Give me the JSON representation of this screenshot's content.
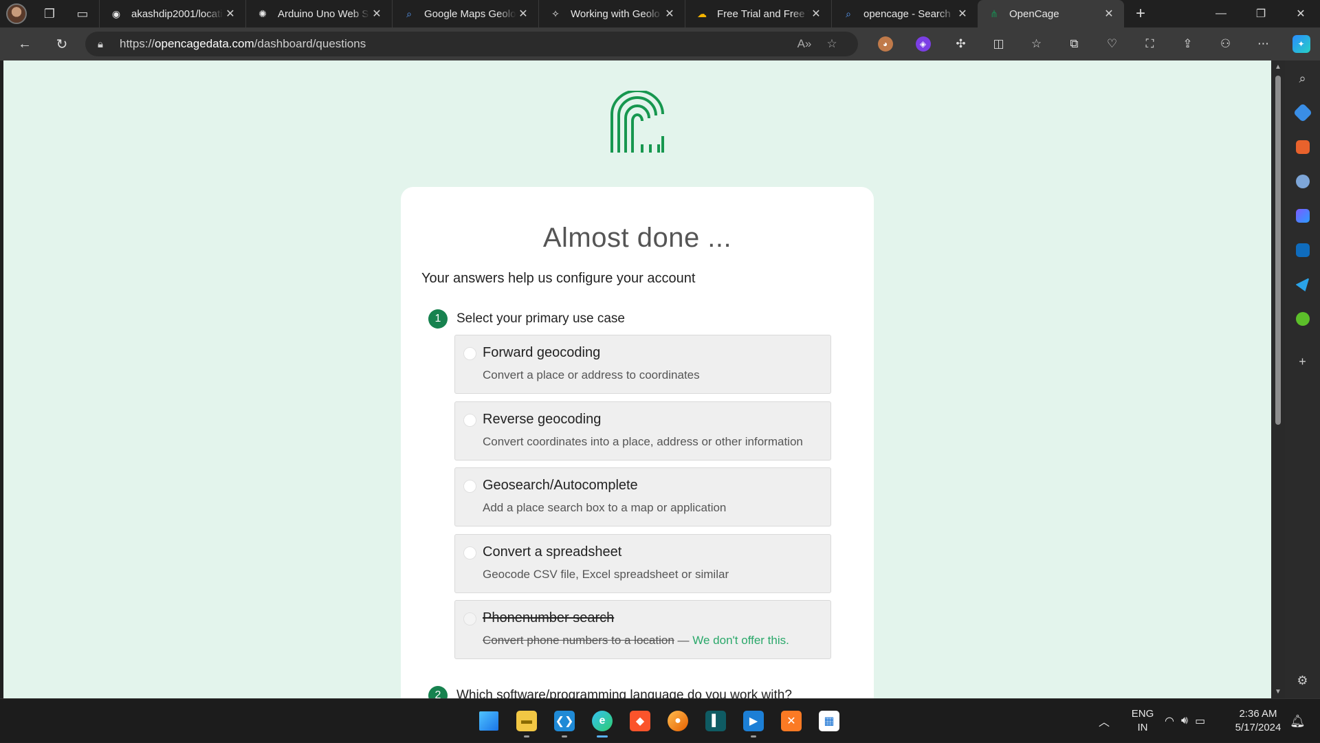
{
  "browser": {
    "tabs": [
      {
        "title": "akashdip2001/locati",
        "icon": "github-icon",
        "glyph": "◉"
      },
      {
        "title": "Arduino Uno Web S",
        "icon": "chatgpt-icon",
        "glyph": "✺"
      },
      {
        "title": "Google Maps Geolo",
        "icon": "search-icon",
        "glyph": "⌕"
      },
      {
        "title": "Working with Geolo",
        "icon": "geolocation-icon",
        "glyph": "✧"
      },
      {
        "title": "Free Trial and Free T",
        "icon": "google-cloud-icon",
        "glyph": "☁"
      },
      {
        "title": "opencage - Search",
        "icon": "bing-search-icon",
        "glyph": "⌕"
      },
      {
        "title": "OpenCage",
        "icon": "opencage-favicon",
        "glyph": "⋔",
        "active": true
      }
    ],
    "url_prefix": "https://",
    "url_host": "opencagedata.com",
    "url_path": "/dashboard/questions"
  },
  "page": {
    "heading": "Almost done ...",
    "intro": "Your answers help us configure your account",
    "step1": {
      "number": "1",
      "question": "Select your primary use case"
    },
    "options": [
      {
        "title": "Forward geocoding",
        "desc": "Convert a place or address to coordinates"
      },
      {
        "title": "Reverse geocoding",
        "desc": "Convert coordinates into a place, address or other information"
      },
      {
        "title": "Geosearch/Autocomplete",
        "desc": "Add a place search box to a map or application"
      },
      {
        "title": "Convert a spreadsheet",
        "desc": "Geocode CSV file, Excel spreadsheet or similar"
      },
      {
        "title": "Phonenumber search",
        "desc": "Convert phone numbers to a location",
        "separator": "—",
        "note": "We don't offer this."
      }
    ],
    "step2": {
      "number": "2",
      "question": "Which software/programming language do you work with?"
    }
  },
  "taskbar": {
    "language": "ENG",
    "region": "IN",
    "time": "2:36 AM",
    "date": "5/17/2024"
  },
  "colors": {
    "accent": "#17824f",
    "page_bg": "#e3f4ec",
    "link_green": "#2aa86a"
  }
}
